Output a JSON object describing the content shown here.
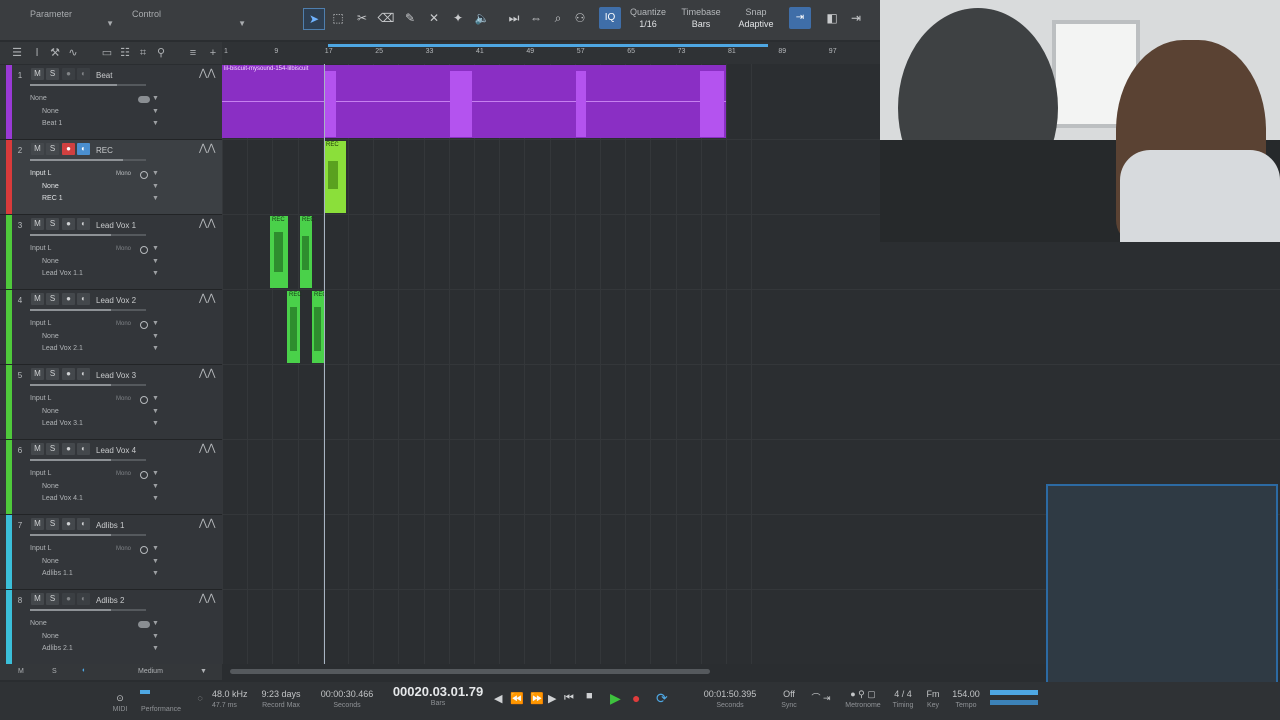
{
  "toolbar": {
    "parameter_label": "Parameter",
    "control_label": "Control",
    "quantize": {
      "label": "Quantize",
      "value": "1/16"
    },
    "timebase": {
      "label": "Timebase",
      "value": "Bars"
    },
    "snap": {
      "label": "Snap",
      "value": "Adaptive"
    },
    "iq_label": "IQ"
  },
  "ruler": {
    "ticks": [
      "1",
      "9",
      "17",
      "25",
      "33",
      "41",
      "49",
      "57",
      "65",
      "73",
      "81",
      "89",
      "97"
    ]
  },
  "tracks": [
    {
      "num": "1",
      "name": "Beat",
      "line1": "None",
      "line2": "None",
      "line3": "Beat 1",
      "color": "#9a3ad6",
      "vol": 0.75
    },
    {
      "num": "2",
      "name": "REC",
      "line1": "Input L",
      "line2": "None",
      "line3": "REC 1",
      "mono": "Mono",
      "color": "#d93b3b",
      "vol": 0.8
    },
    {
      "num": "3",
      "name": "Lead Vox 1",
      "line1": "Input L",
      "line2": "None",
      "line3": "Lead Vox 1.1",
      "mono": "Mono",
      "color": "#4fc93b",
      "vol": 0.7
    },
    {
      "num": "4",
      "name": "Lead Vox 2",
      "line1": "Input L",
      "line2": "None",
      "line3": "Lead Vox 2.1",
      "mono": "Mono",
      "color": "#4fc93b",
      "vol": 0.7
    },
    {
      "num": "5",
      "name": "Lead Vox 3",
      "line1": "Input L",
      "line2": "None",
      "line3": "Lead Vox 3.1",
      "mono": "Mono",
      "color": "#4fc93b",
      "vol": 0.7
    },
    {
      "num": "6",
      "name": "Lead Vox 4",
      "line1": "Input L",
      "line2": "None",
      "line3": "Lead Vox 4.1",
      "mono": "Mono",
      "color": "#4fc93b",
      "vol": 0.7
    },
    {
      "num": "7",
      "name": "Adlibs 1",
      "line1": "Input L",
      "line2": "None",
      "line3": "Adlibs 1.1",
      "mono": "Mono",
      "color": "#3bbfd9",
      "vol": 0.7
    },
    {
      "num": "8",
      "name": "Adlibs 2",
      "line1": "None",
      "line2": "None",
      "line3": "Adlibs 2.1",
      "color": "#3bbfd9",
      "vol": 0.7
    }
  ],
  "track_buttons": {
    "mute": "M",
    "solo": "S"
  },
  "tracklist_bottom": {
    "m": "M",
    "s": "S",
    "size": "Medium"
  },
  "events": {
    "beat_clip_label": "lil-biscuit-mysound-154-lilbiscuit",
    "rec_label": "REC",
    "vox_label": "REC"
  },
  "transport": {
    "midi_label": "MIDI",
    "performance_label": "Performance",
    "sample_rate": "48.0 kHz",
    "latency": "47.7 ms",
    "record_time": "9:23 days",
    "record_max_label": "Record Max",
    "seconds_value": "00:00:30.466",
    "seconds_label": "Seconds",
    "bars_position": "00020.03.01.79",
    "bars_label": "Bars",
    "loop_end": "00:01:50.395",
    "loop_end_label": "Seconds",
    "sync_value": "Off",
    "sync_label": "Sync",
    "metronome_label": "Metronome",
    "timing_value": "4 / 4",
    "timing_label": "Timing",
    "key_value": "Fm",
    "key_label": "Key",
    "tempo_value": "154.00",
    "tempo_label": "Tempo"
  },
  "colors": {
    "beat_purple": "#9a3ad6",
    "rec_green": "#7fe23a",
    "vox_green": "#4ad14a",
    "accent_blue": "#4ea7e3"
  }
}
